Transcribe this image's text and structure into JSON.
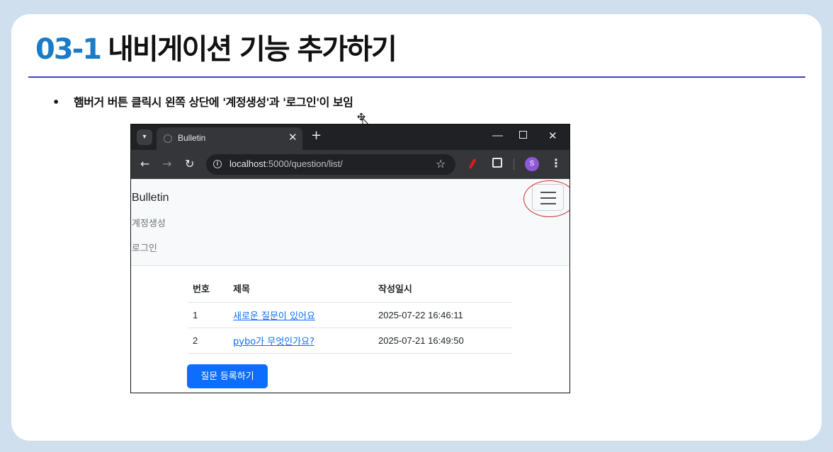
{
  "slide": {
    "number": "03-1",
    "title": "내비게이션 기능 추가하기",
    "bullet": "햄버거 버튼 클릭시 왼쪽 상단에 '계정생성'과 '로그인'이 보임"
  },
  "browser": {
    "tab_title": "Bulletin",
    "url_host": "localhost",
    "url_path": ":5000/question/list/",
    "profile_initial": "S"
  },
  "navbar": {
    "brand": "Bulletin",
    "links": [
      "계정생성",
      "로그인"
    ]
  },
  "table": {
    "headers": [
      "번호",
      "제목",
      "작성일시"
    ],
    "rows": [
      {
        "num": "1",
        "subject": "새로운 질문이 있어요",
        "date": "2025-07-22 16:46:11"
      },
      {
        "num": "2",
        "subject": "pybo가 무엇인가요?",
        "date": "2025-07-21 16:49:50"
      }
    ]
  },
  "ask_button": "질문 등록하기",
  "colors": {
    "title_number": "#1a7bc6",
    "rule": "#3f3fc4",
    "button": "#0d6efd",
    "highlight_ring": "#c9302c"
  }
}
